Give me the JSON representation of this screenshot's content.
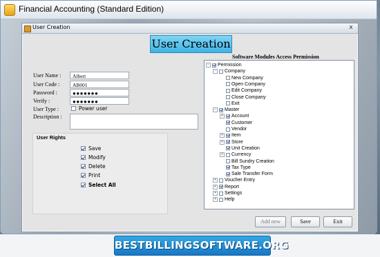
{
  "app": {
    "title": "Financial Accounting (Standard Edition)"
  },
  "dialog": {
    "title": "User Creation",
    "close": "x",
    "banner": "User Creation"
  },
  "form": {
    "user_name_label": "User Name :",
    "user_name_value": "Albert",
    "user_code_label": "User Code :",
    "user_code_value": "AB001",
    "password_label": "Password :",
    "password_value": "●●●●●●●",
    "verify_label": "Verify :",
    "verify_value": "●●●●●●●",
    "user_type_label": "User Type :",
    "power_user_label": "Power user",
    "power_user_checked": false,
    "description_label": "Description :",
    "description_value": ""
  },
  "rights": {
    "heading": "User Rights",
    "items": [
      {
        "label": "Save",
        "checked": true
      },
      {
        "label": "Modify",
        "checked": true
      },
      {
        "label": "Delete",
        "checked": true
      },
      {
        "label": "Print",
        "checked": true
      },
      {
        "label": "Select All",
        "checked": true
      }
    ]
  },
  "tree": {
    "title": "Software Modules Access Permission",
    "nodes": [
      {
        "label": "Permission",
        "level": 0,
        "expander": "−",
        "checked": true
      },
      {
        "label": "Company",
        "level": 1,
        "expander": "−",
        "checked": false
      },
      {
        "label": "New Company",
        "level": 2,
        "expander": "",
        "checked": false
      },
      {
        "label": "Open Company",
        "level": 2,
        "expander": "",
        "checked": false
      },
      {
        "label": "Edit Company",
        "level": 2,
        "expander": "",
        "checked": false
      },
      {
        "label": "Close Company",
        "level": 2,
        "expander": "",
        "checked": false
      },
      {
        "label": "Exit",
        "level": 2,
        "expander": "",
        "checked": false
      },
      {
        "label": "Master",
        "level": 1,
        "expander": "−",
        "checked": true
      },
      {
        "label": "Account",
        "level": 2,
        "expander": "+",
        "checked": true
      },
      {
        "label": "Customer",
        "level": 2,
        "expander": "",
        "checked": true
      },
      {
        "label": "Vendor",
        "level": 2,
        "expander": "",
        "checked": false
      },
      {
        "label": "Item",
        "level": 2,
        "expander": "+",
        "checked": true
      },
      {
        "label": "Store",
        "level": 2,
        "expander": "+",
        "checked": true
      },
      {
        "label": "Unit Creation",
        "level": 2,
        "expander": "",
        "checked": true
      },
      {
        "label": "Currency",
        "level": 2,
        "expander": "+",
        "checked": false
      },
      {
        "label": "Bill Sundry Creation",
        "level": 2,
        "expander": "",
        "checked": false
      },
      {
        "label": "Tax Type",
        "level": 2,
        "expander": "",
        "checked": true
      },
      {
        "label": "Sale Transfer Form",
        "level": 2,
        "expander": "",
        "checked": true
      },
      {
        "label": "Voucher Entry",
        "level": 1,
        "expander": "+",
        "checked": false
      },
      {
        "label": "Report",
        "level": 1,
        "expander": "+",
        "checked": true
      },
      {
        "label": "Settings",
        "level": 1,
        "expander": "+",
        "checked": false
      },
      {
        "label": "Help",
        "level": 1,
        "expander": "+",
        "checked": false
      }
    ]
  },
  "buttons": {
    "add_new": "Add new",
    "save": "Save",
    "exit": "Exit"
  },
  "footer": {
    "logo": "BESTBILLINGSOFTWARE.ORG"
  }
}
